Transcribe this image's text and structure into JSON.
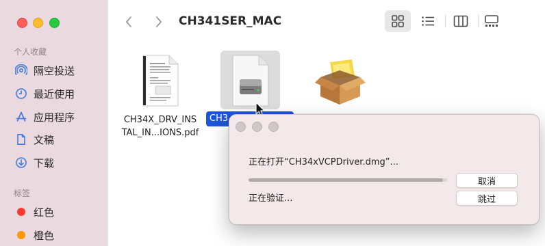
{
  "window": {
    "title": "CH341SER_MAC"
  },
  "sidebar": {
    "favorites_title": "个人收藏",
    "favorites": [
      {
        "label": "隔空投送",
        "icon": "airdrop-icon"
      },
      {
        "label": "最近使用",
        "icon": "clock-icon"
      },
      {
        "label": "应用程序",
        "icon": "applications-icon"
      },
      {
        "label": "文稿",
        "icon": "document-icon"
      },
      {
        "label": "下载",
        "icon": "download-icon"
      }
    ],
    "tags_title": "标签",
    "tags": [
      {
        "label": "红色",
        "color": "#ff3b30"
      },
      {
        "label": "橙色",
        "color": "#ff9500"
      }
    ]
  },
  "files": [
    {
      "name_line1": "CH34X_DRV_INS",
      "name_line2": "TAL_IN...IONS.pdf",
      "icon": "pdf-document-icon"
    },
    {
      "name": "CH3",
      "icon": "disk-image-icon",
      "selected": true
    },
    {
      "name": "",
      "icon": "package-installer-icon"
    }
  ],
  "dialog": {
    "message": "正在打开“CH34xVCPDriver.dmg”...",
    "status": "正在验证...",
    "progress": 0.98,
    "cancel_label": "取消",
    "skip_label": "跳过"
  },
  "colors": {
    "accent": "#1f56d6",
    "sidebar_bg": "#ead9de"
  }
}
